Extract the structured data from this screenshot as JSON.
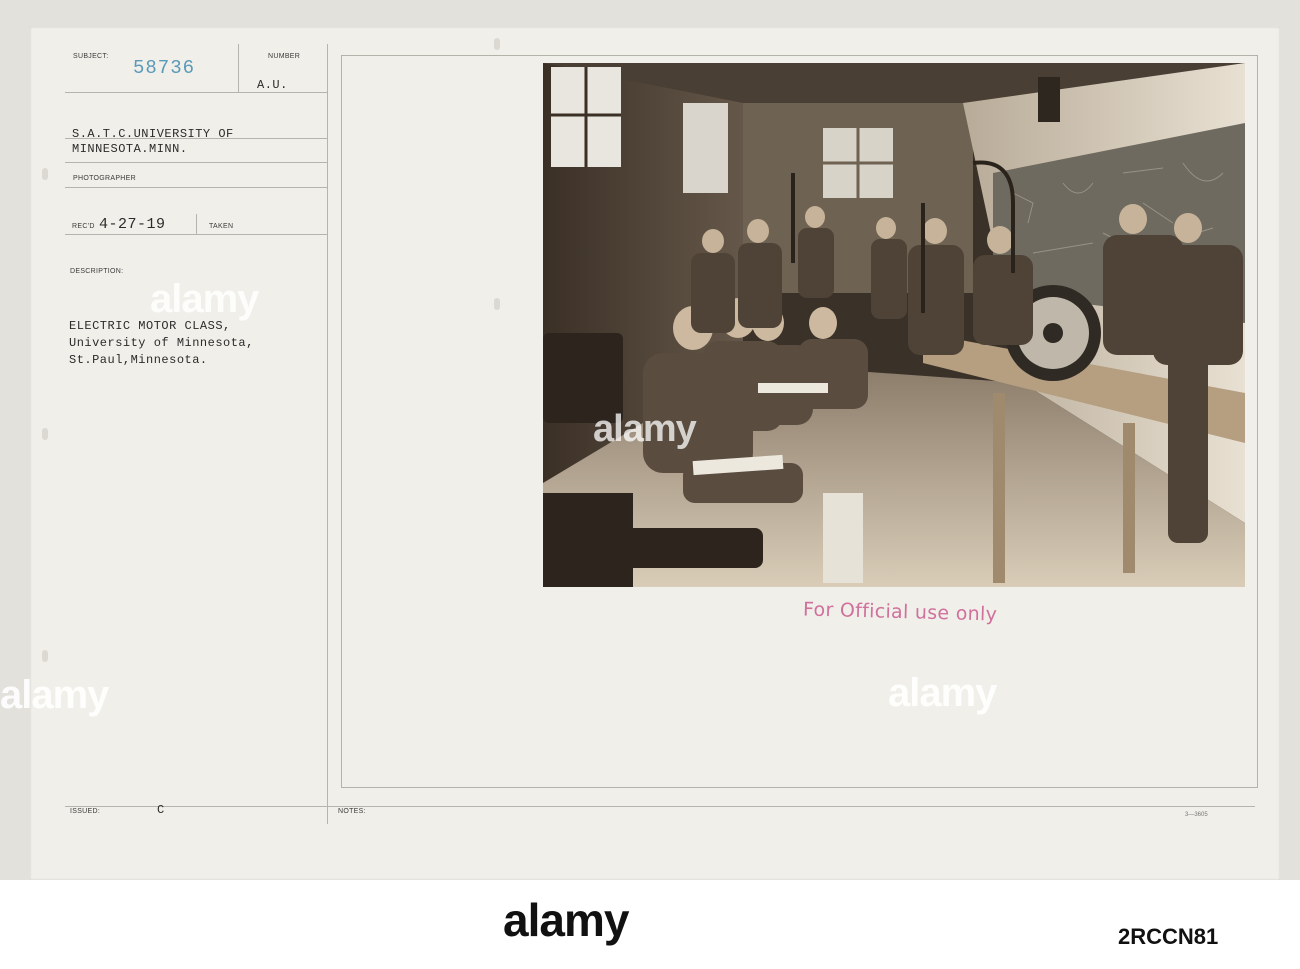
{
  "card": {
    "labels": {
      "subject": "SUBJECT:",
      "number": "NUMBER",
      "photographer": "PHOTOGRAPHER",
      "recd": "REC'D",
      "taken": "TAKEN",
      "description": "DESCRIPTION:",
      "issued": "ISSUED:",
      "notes": "NOTES:"
    },
    "serial_number": "58736",
    "number_value": "A.U.",
    "subject_lines": [
      "S.A.T.C.UNIVERSITY OF",
      "MINNESOTA.MINN."
    ],
    "recd_date": "4-27-19",
    "description_lines": [
      "ELECTRIC MOTOR CLASS,",
      "University of Minnesota,",
      "St.Paul,Minnesota."
    ],
    "issued_value": "C",
    "form_code": "3—3605",
    "stamp": "For Official use only"
  },
  "watermarks": {
    "text": "alamy"
  },
  "footer": {
    "brand": "alamy",
    "image_id": "2RCCN81"
  },
  "colors": {
    "card_bg": "#f1efe9",
    "serial_blue": "#5a9ab8",
    "stamp_pink": "#d0709c"
  }
}
